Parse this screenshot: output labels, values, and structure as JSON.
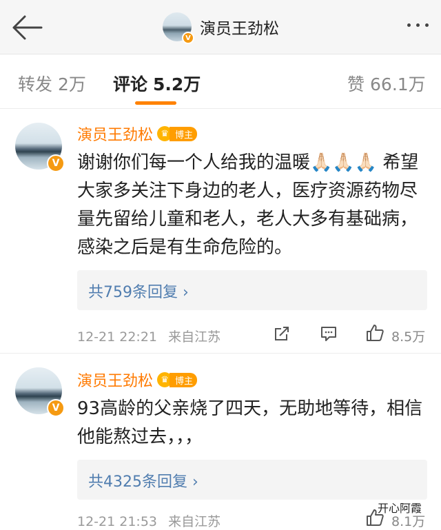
{
  "header": {
    "title": "演员王劲松",
    "back_icon": "arrow-left-icon",
    "more_icon": "more-dots-icon",
    "verified_mark": "V"
  },
  "tabs": [
    {
      "label": "转发",
      "count": "2万",
      "active": false
    },
    {
      "label": "评论",
      "count": "5.2万",
      "active": true
    },
    {
      "label": "赞",
      "count": "66.1万",
      "active": false
    }
  ],
  "comments": [
    {
      "author": "演员王劲松",
      "tag": "博主",
      "text": "谢谢你们每一个人给我的温暖🙏🏻🙏🏻🙏🏻 希望大家多关注下身边的老人，医疗资源药物尽量先留给儿童和老人，老人大多有基础病，感染之后是有生命危险的。",
      "replies": "共759条回复",
      "time": "12-21 22:21",
      "source": "来自江苏",
      "likes": "8.5万"
    },
    {
      "author": "演员王劲松",
      "tag": "博主",
      "text": "93高龄的父亲烧了四天，无助地等待，相信他能熬过去，，，",
      "replies": "共4325条回复",
      "time": "12-21 21:53",
      "source": "来自江苏",
      "likes": "8.1万"
    }
  ],
  "watermark": "开心阿霞",
  "colors": {
    "accent": "#ff8200",
    "name": "#ff7a00",
    "link": "#507daf",
    "badge": "#f59a12"
  }
}
